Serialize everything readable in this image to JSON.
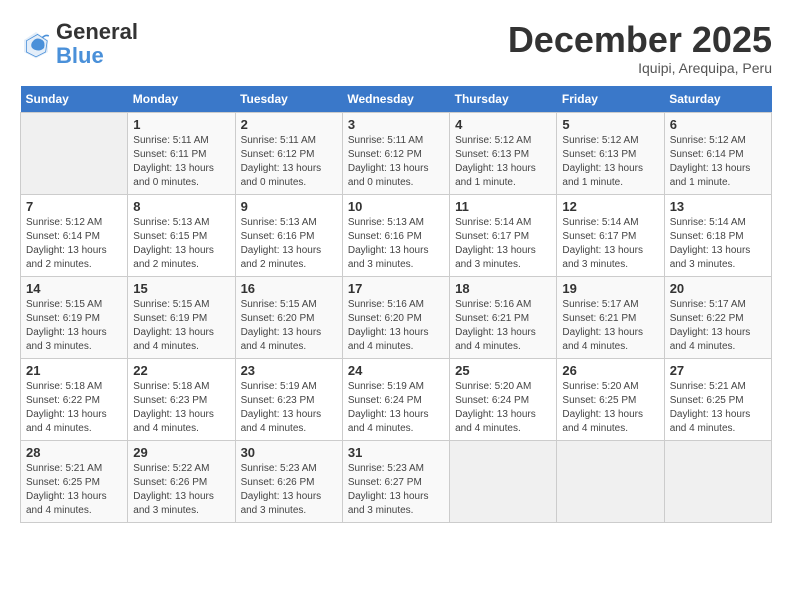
{
  "logo": {
    "general": "General",
    "blue": "Blue"
  },
  "header": {
    "month_title": "December 2025",
    "location": "Iquipi, Arequipa, Peru"
  },
  "days_of_week": [
    "Sunday",
    "Monday",
    "Tuesday",
    "Wednesday",
    "Thursday",
    "Friday",
    "Saturday"
  ],
  "weeks": [
    [
      {
        "day": "",
        "sunrise": "",
        "sunset": "",
        "daylight": ""
      },
      {
        "day": "1",
        "sunrise": "Sunrise: 5:11 AM",
        "sunset": "Sunset: 6:11 PM",
        "daylight": "Daylight: 13 hours and 0 minutes."
      },
      {
        "day": "2",
        "sunrise": "Sunrise: 5:11 AM",
        "sunset": "Sunset: 6:12 PM",
        "daylight": "Daylight: 13 hours and 0 minutes."
      },
      {
        "day": "3",
        "sunrise": "Sunrise: 5:11 AM",
        "sunset": "Sunset: 6:12 PM",
        "daylight": "Daylight: 13 hours and 0 minutes."
      },
      {
        "day": "4",
        "sunrise": "Sunrise: 5:12 AM",
        "sunset": "Sunset: 6:13 PM",
        "daylight": "Daylight: 13 hours and 1 minute."
      },
      {
        "day": "5",
        "sunrise": "Sunrise: 5:12 AM",
        "sunset": "Sunset: 6:13 PM",
        "daylight": "Daylight: 13 hours and 1 minute."
      },
      {
        "day": "6",
        "sunrise": "Sunrise: 5:12 AM",
        "sunset": "Sunset: 6:14 PM",
        "daylight": "Daylight: 13 hours and 1 minute."
      }
    ],
    [
      {
        "day": "7",
        "sunrise": "Sunrise: 5:12 AM",
        "sunset": "Sunset: 6:14 PM",
        "daylight": "Daylight: 13 hours and 2 minutes."
      },
      {
        "day": "8",
        "sunrise": "Sunrise: 5:13 AM",
        "sunset": "Sunset: 6:15 PM",
        "daylight": "Daylight: 13 hours and 2 minutes."
      },
      {
        "day": "9",
        "sunrise": "Sunrise: 5:13 AM",
        "sunset": "Sunset: 6:16 PM",
        "daylight": "Daylight: 13 hours and 2 minutes."
      },
      {
        "day": "10",
        "sunrise": "Sunrise: 5:13 AM",
        "sunset": "Sunset: 6:16 PM",
        "daylight": "Daylight: 13 hours and 3 minutes."
      },
      {
        "day": "11",
        "sunrise": "Sunrise: 5:14 AM",
        "sunset": "Sunset: 6:17 PM",
        "daylight": "Daylight: 13 hours and 3 minutes."
      },
      {
        "day": "12",
        "sunrise": "Sunrise: 5:14 AM",
        "sunset": "Sunset: 6:17 PM",
        "daylight": "Daylight: 13 hours and 3 minutes."
      },
      {
        "day": "13",
        "sunrise": "Sunrise: 5:14 AM",
        "sunset": "Sunset: 6:18 PM",
        "daylight": "Daylight: 13 hours and 3 minutes."
      }
    ],
    [
      {
        "day": "14",
        "sunrise": "Sunrise: 5:15 AM",
        "sunset": "Sunset: 6:19 PM",
        "daylight": "Daylight: 13 hours and 3 minutes."
      },
      {
        "day": "15",
        "sunrise": "Sunrise: 5:15 AM",
        "sunset": "Sunset: 6:19 PM",
        "daylight": "Daylight: 13 hours and 4 minutes."
      },
      {
        "day": "16",
        "sunrise": "Sunrise: 5:15 AM",
        "sunset": "Sunset: 6:20 PM",
        "daylight": "Daylight: 13 hours and 4 minutes."
      },
      {
        "day": "17",
        "sunrise": "Sunrise: 5:16 AM",
        "sunset": "Sunset: 6:20 PM",
        "daylight": "Daylight: 13 hours and 4 minutes."
      },
      {
        "day": "18",
        "sunrise": "Sunrise: 5:16 AM",
        "sunset": "Sunset: 6:21 PM",
        "daylight": "Daylight: 13 hours and 4 minutes."
      },
      {
        "day": "19",
        "sunrise": "Sunrise: 5:17 AM",
        "sunset": "Sunset: 6:21 PM",
        "daylight": "Daylight: 13 hours and 4 minutes."
      },
      {
        "day": "20",
        "sunrise": "Sunrise: 5:17 AM",
        "sunset": "Sunset: 6:22 PM",
        "daylight": "Daylight: 13 hours and 4 minutes."
      }
    ],
    [
      {
        "day": "21",
        "sunrise": "Sunrise: 5:18 AM",
        "sunset": "Sunset: 6:22 PM",
        "daylight": "Daylight: 13 hours and 4 minutes."
      },
      {
        "day": "22",
        "sunrise": "Sunrise: 5:18 AM",
        "sunset": "Sunset: 6:23 PM",
        "daylight": "Daylight: 13 hours and 4 minutes."
      },
      {
        "day": "23",
        "sunrise": "Sunrise: 5:19 AM",
        "sunset": "Sunset: 6:23 PM",
        "daylight": "Daylight: 13 hours and 4 minutes."
      },
      {
        "day": "24",
        "sunrise": "Sunrise: 5:19 AM",
        "sunset": "Sunset: 6:24 PM",
        "daylight": "Daylight: 13 hours and 4 minutes."
      },
      {
        "day": "25",
        "sunrise": "Sunrise: 5:20 AM",
        "sunset": "Sunset: 6:24 PM",
        "daylight": "Daylight: 13 hours and 4 minutes."
      },
      {
        "day": "26",
        "sunrise": "Sunrise: 5:20 AM",
        "sunset": "Sunset: 6:25 PM",
        "daylight": "Daylight: 13 hours and 4 minutes."
      },
      {
        "day": "27",
        "sunrise": "Sunrise: 5:21 AM",
        "sunset": "Sunset: 6:25 PM",
        "daylight": "Daylight: 13 hours and 4 minutes."
      }
    ],
    [
      {
        "day": "28",
        "sunrise": "Sunrise: 5:21 AM",
        "sunset": "Sunset: 6:25 PM",
        "daylight": "Daylight: 13 hours and 4 minutes."
      },
      {
        "day": "29",
        "sunrise": "Sunrise: 5:22 AM",
        "sunset": "Sunset: 6:26 PM",
        "daylight": "Daylight: 13 hours and 3 minutes."
      },
      {
        "day": "30",
        "sunrise": "Sunrise: 5:23 AM",
        "sunset": "Sunset: 6:26 PM",
        "daylight": "Daylight: 13 hours and 3 minutes."
      },
      {
        "day": "31",
        "sunrise": "Sunrise: 5:23 AM",
        "sunset": "Sunset: 6:27 PM",
        "daylight": "Daylight: 13 hours and 3 minutes."
      },
      {
        "day": "",
        "sunrise": "",
        "sunset": "",
        "daylight": ""
      },
      {
        "day": "",
        "sunrise": "",
        "sunset": "",
        "daylight": ""
      },
      {
        "day": "",
        "sunrise": "",
        "sunset": "",
        "daylight": ""
      }
    ]
  ]
}
